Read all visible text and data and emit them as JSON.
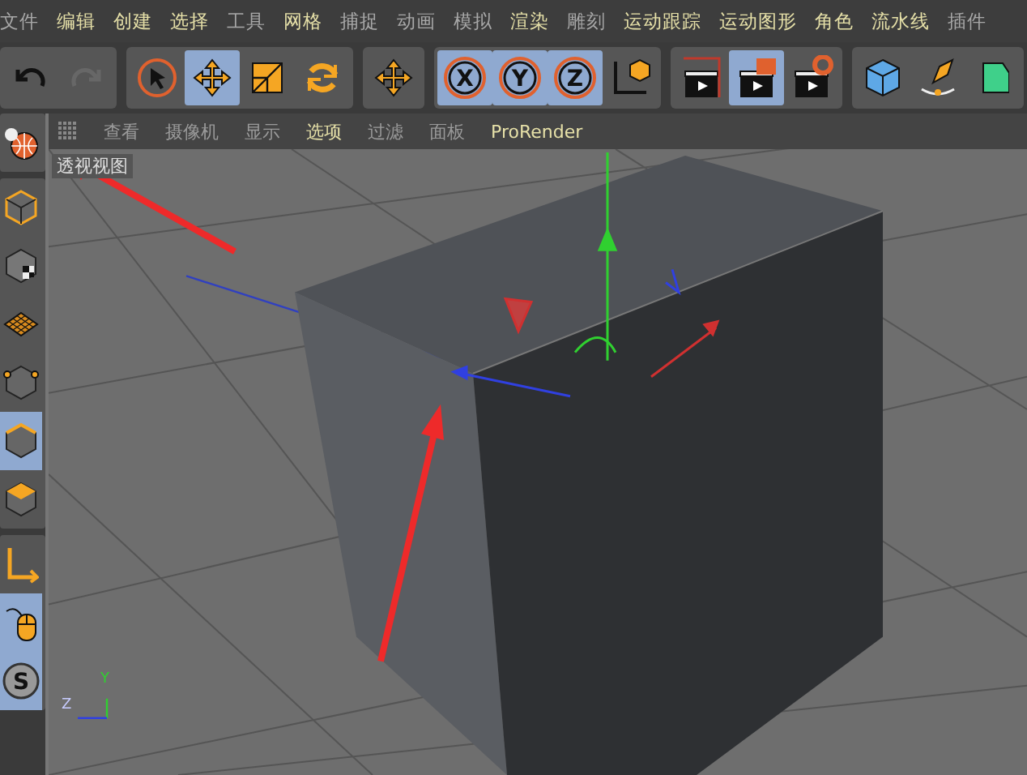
{
  "menu": [
    {
      "label": "文件",
      "highlighted": false
    },
    {
      "label": "编辑",
      "highlighted": true
    },
    {
      "label": "创建",
      "highlighted": true
    },
    {
      "label": "选择",
      "highlighted": true
    },
    {
      "label": "工具",
      "highlighted": false
    },
    {
      "label": "网格",
      "highlighted": true
    },
    {
      "label": "捕捉",
      "highlighted": false
    },
    {
      "label": "动画",
      "highlighted": false
    },
    {
      "label": "模拟",
      "highlighted": false
    },
    {
      "label": "渲染",
      "highlighted": true
    },
    {
      "label": "雕刻",
      "highlighted": false
    },
    {
      "label": "运动跟踪",
      "highlighted": true
    },
    {
      "label": "运动图形",
      "highlighted": true
    },
    {
      "label": "角色",
      "highlighted": true
    },
    {
      "label": "流水线",
      "highlighted": true
    },
    {
      "label": "插件",
      "highlighted": false
    }
  ],
  "toolbar_groups": [
    {
      "buttons": [
        {
          "kind": "undo",
          "active": false,
          "disabled": false
        },
        {
          "kind": "redo",
          "active": false,
          "disabled": true
        }
      ]
    },
    {
      "buttons": [
        {
          "kind": "select",
          "active": false,
          "disabled": false
        },
        {
          "kind": "move",
          "active": true,
          "disabled": false
        },
        {
          "kind": "scale",
          "active": false,
          "disabled": false
        },
        {
          "kind": "rotate",
          "active": false,
          "disabled": false
        }
      ]
    },
    {
      "buttons": [
        {
          "kind": "move",
          "active": false,
          "disabled": false
        }
      ]
    },
    {
      "buttons": [
        {
          "kind": "axis",
          "letter": "X",
          "active": true,
          "disabled": false
        },
        {
          "kind": "axis",
          "letter": "Y",
          "active": true,
          "disabled": false
        },
        {
          "kind": "axis",
          "letter": "Z",
          "active": true,
          "disabled": false
        },
        {
          "kind": "coords",
          "active": false,
          "disabled": false
        }
      ]
    },
    {
      "buttons": [
        {
          "kind": "render-view",
          "active": false,
          "disabled": false
        },
        {
          "kind": "render",
          "active": true,
          "disabled": false
        },
        {
          "kind": "render-settings",
          "active": false,
          "disabled": false
        }
      ]
    },
    {
      "buttons": [
        {
          "kind": "cube",
          "active": false,
          "disabled": false
        },
        {
          "kind": "pen",
          "active": false,
          "disabled": false
        },
        {
          "kind": "subdiv",
          "active": false,
          "disabled": false
        }
      ]
    }
  ],
  "left_tool_groups": [
    {
      "tools": [
        {
          "kind": "globe",
          "active": false
        }
      ]
    },
    {
      "tools": [
        {
          "kind": "cube-outline",
          "active": false
        },
        {
          "kind": "texture",
          "active": false
        },
        {
          "kind": "grid",
          "active": false
        },
        {
          "kind": "points",
          "active": false
        },
        {
          "kind": "edges",
          "active": true
        },
        {
          "kind": "faces",
          "active": false
        }
      ]
    },
    {
      "tools": [
        {
          "kind": "axis-tool",
          "active": false
        },
        {
          "kind": "mouse",
          "active": true
        },
        {
          "kind": "snap",
          "letter": "S",
          "active": true
        }
      ]
    }
  ],
  "view_menu": [
    {
      "label": "查看",
      "highlighted": false
    },
    {
      "label": "摄像机",
      "highlighted": false
    },
    {
      "label": "显示",
      "highlighted": false
    },
    {
      "label": "选项",
      "highlighted": true
    },
    {
      "label": "过滤",
      "highlighted": false
    },
    {
      "label": "面板",
      "highlighted": false
    },
    {
      "label": "ProRender",
      "highlighted": true
    }
  ],
  "viewport": {
    "label": "透视视图",
    "axis_labels": [
      "Y",
      "Z"
    ]
  }
}
